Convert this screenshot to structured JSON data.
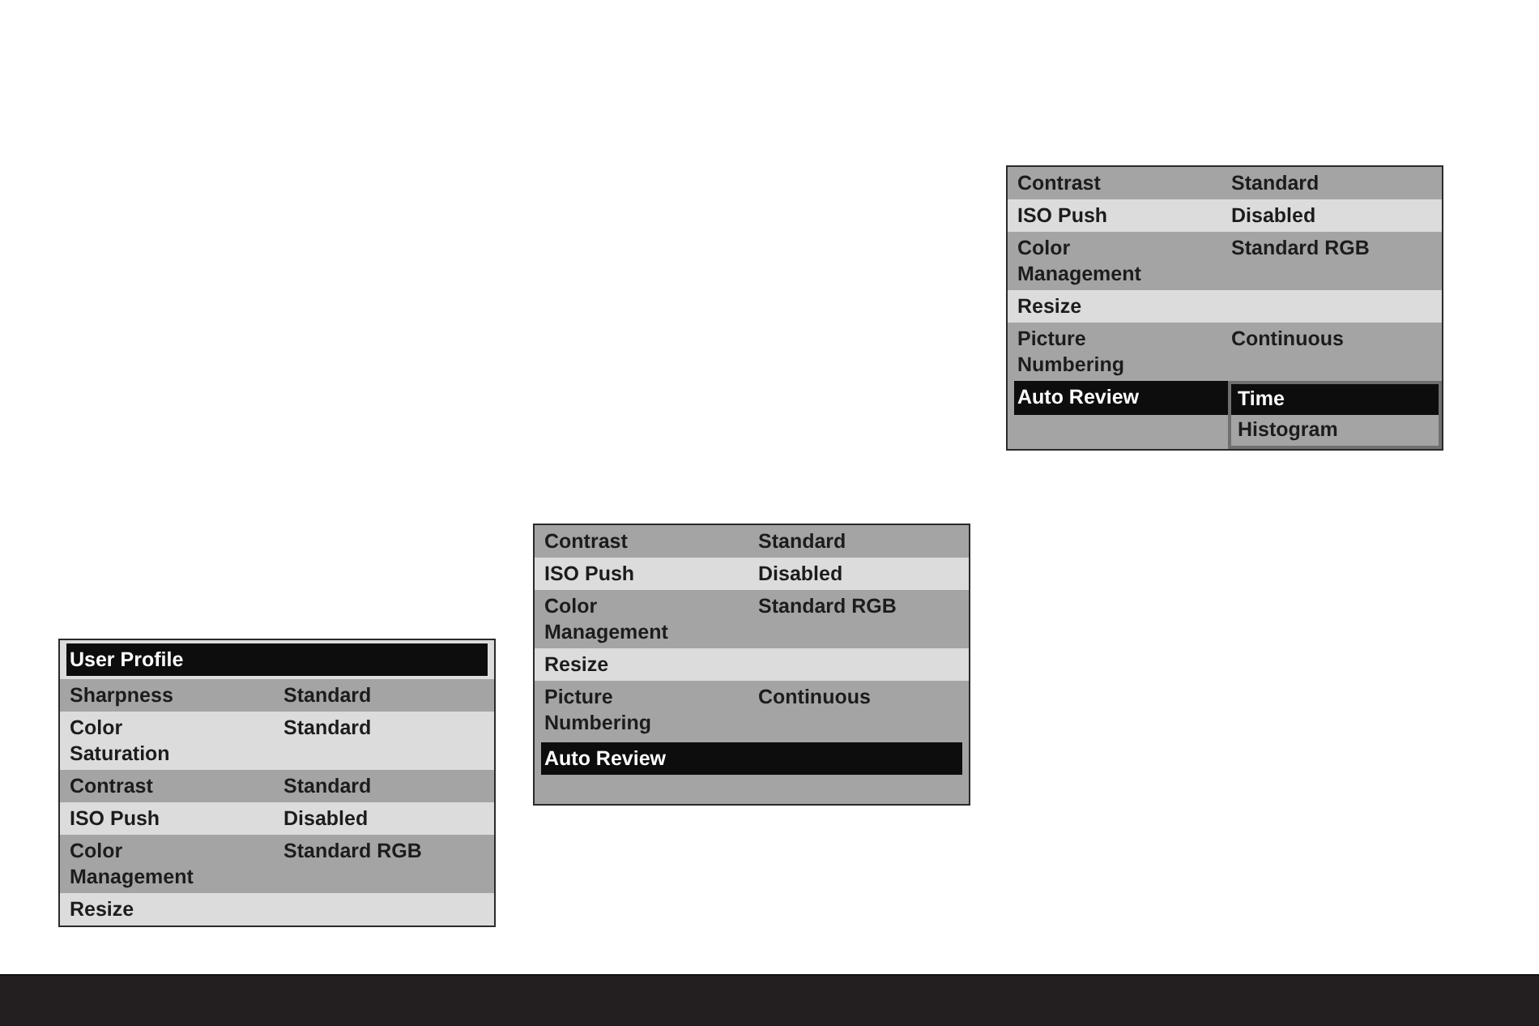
{
  "screens": [
    {
      "rows": [
        {
          "label": "User Profile",
          "selected": true,
          "shaded": false
        },
        {
          "label": "Sharpness",
          "value": "Standard",
          "selected": false,
          "shaded": true
        },
        {
          "label": "Color Saturation",
          "value": "Standard",
          "selected": false,
          "shaded": false
        },
        {
          "label": "Contrast",
          "value": "Standard",
          "selected": false,
          "shaded": true
        },
        {
          "label": "ISO Push",
          "value": "Disabled",
          "selected": false,
          "shaded": false
        },
        {
          "label": "Color Management",
          "value": "Standard RGB",
          "selected": false,
          "shaded": true
        },
        {
          "label": "Resize",
          "selected": false,
          "shaded": false
        }
      ]
    },
    {
      "rows": [
        {
          "label": "Contrast",
          "value": "Standard",
          "selected": false,
          "shaded": true
        },
        {
          "label": "ISO Push",
          "value": "Disabled",
          "selected": false,
          "shaded": false
        },
        {
          "label": "Color Management",
          "value": "Standard RGB",
          "selected": false,
          "shaded": true
        },
        {
          "label": "Resize",
          "selected": false,
          "shaded": false
        },
        {
          "label": "Picture Numbering",
          "value": "Continuous",
          "selected": false,
          "shaded": true
        },
        {
          "label": "Auto Review",
          "selected": true,
          "shaded": true
        }
      ]
    },
    {
      "rows": [
        {
          "label": "Contrast",
          "value": "Standard",
          "selected": false,
          "shaded": true
        },
        {
          "label": "ISO Push",
          "value": "Disabled",
          "selected": false,
          "shaded": false
        },
        {
          "label": "Color Management",
          "value": "Standard RGB",
          "selected": false,
          "shaded": true
        },
        {
          "label": "Resize",
          "selected": false,
          "shaded": false
        },
        {
          "label": "Picture Numbering",
          "value": "Continuous",
          "selected": false,
          "shaded": true
        },
        {
          "label": "Auto Review",
          "selected": true,
          "shaded": true,
          "options": [
            {
              "label": "Time",
              "selected": true
            },
            {
              "label": "Histogram",
              "selected": false
            }
          ]
        }
      ]
    }
  ]
}
